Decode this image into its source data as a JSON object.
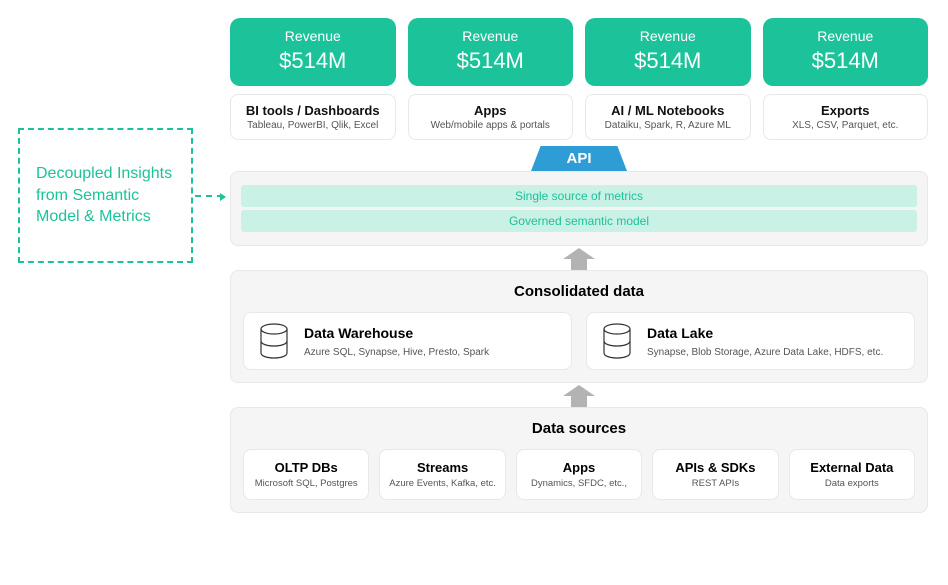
{
  "callout": {
    "text": "Decoupled Insights from Semantic Model & Metrics"
  },
  "revenue_cards": [
    {
      "label": "Revenue",
      "value": "$514M"
    },
    {
      "label": "Revenue",
      "value": "$514M"
    },
    {
      "label": "Revenue",
      "value": "$514M"
    },
    {
      "label": "Revenue",
      "value": "$514M"
    }
  ],
  "tools": [
    {
      "title": "BI tools / Dashboards",
      "sub": "Tableau, PowerBI, Qlik, Excel"
    },
    {
      "title": "Apps",
      "sub": "Web/mobile apps & portals"
    },
    {
      "title": "AI / ML Notebooks",
      "sub": "Dataiku, Spark, R, Azure ML"
    },
    {
      "title": "Exports",
      "sub": "XLS, CSV, Parquet, etc."
    }
  ],
  "api": {
    "label": "API"
  },
  "semantic": {
    "bar1": "Single source of metrics",
    "bar2": "Governed semantic model"
  },
  "consolidated": {
    "title": "Consolidated data",
    "cards": [
      {
        "name": "Data Warehouse",
        "sub": "Azure SQL, Synapse, Hive, Presto, Spark"
      },
      {
        "name": "Data Lake",
        "sub": "Synapse, Blob Storage, Azure Data Lake, HDFS,  etc."
      }
    ]
  },
  "sources": {
    "title": "Data sources",
    "cards": [
      {
        "title": "OLTP DBs",
        "sub": "Microsoft SQL, Postgres"
      },
      {
        "title": "Streams",
        "sub": "Azure Events, Kafka, etc."
      },
      {
        "title": "Apps",
        "sub": "Dynamics, SFDC, etc.,"
      },
      {
        "title": "APIs & SDKs",
        "sub": "REST APIs"
      },
      {
        "title": "External Data",
        "sub": "Data exports"
      }
    ]
  }
}
